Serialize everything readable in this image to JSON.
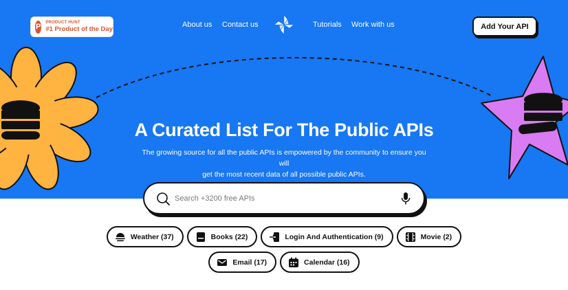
{
  "header": {
    "product_hunt": {
      "top_line": "PRODUCT HUNT",
      "main_line": "#1 Product of the Day",
      "logo_letter": "P",
      "color": "#da552f"
    },
    "nav_left": [
      "About us",
      "Contact us"
    ],
    "nav_right": [
      "Tutorials",
      "Work with us"
    ],
    "logo_icon": "pinwheel-logo-icon",
    "cta_label": "Add Your API"
  },
  "hero": {
    "background": "#1877f2",
    "title": "A Curated List For The Public APIs",
    "subtitle_line1": "The growing source for all the public APIs is empowered by the community to ensure you will",
    "subtitle_line2": "get the most recent data of all possible public APIs.",
    "flower_color": "#ffb340",
    "star_color": "#d97bf2"
  },
  "search": {
    "placeholder": "Search +3200 free APIs",
    "value": "",
    "search_icon": "search-icon",
    "mic_icon": "microphone-icon"
  },
  "categories": {
    "row1": [
      {
        "label": "Weather (37)",
        "icon": "weather-icon"
      },
      {
        "label": "Books (22)",
        "icon": "book-icon"
      },
      {
        "label": "Login And Authentication (9)",
        "icon": "login-icon"
      },
      {
        "label": "Movie (2)",
        "icon": "film-icon"
      }
    ],
    "row2": [
      {
        "label": "Email (17)",
        "icon": "email-icon"
      },
      {
        "label": "Calendar (16)",
        "icon": "calendar-icon"
      }
    ]
  }
}
